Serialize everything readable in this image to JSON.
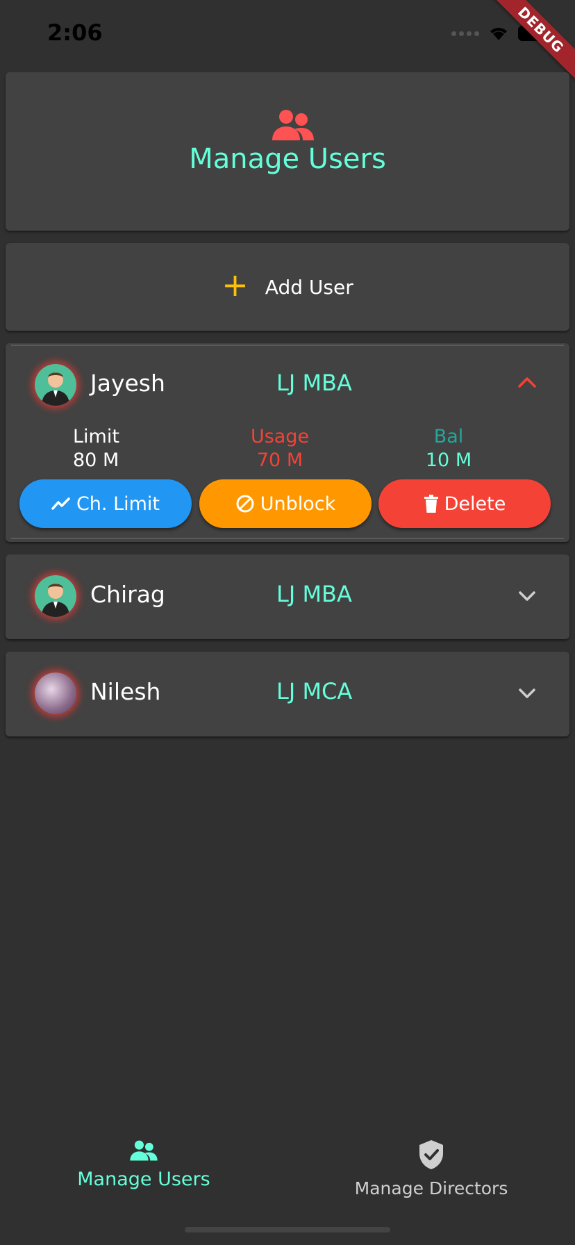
{
  "status_bar": {
    "time": "2:06"
  },
  "debug_banner": "DEBUG",
  "header": {
    "title": "Manage Users",
    "icon": "people-icon",
    "icon_color": "#ff5252"
  },
  "add_user": {
    "label": "Add User",
    "icon": "plus-icon",
    "icon_color": "#ffc107"
  },
  "users": [
    {
      "name": "Jayesh",
      "org": "LJ MBA",
      "expanded": true,
      "stats": [
        {
          "label": "Limit",
          "value": "80 M"
        },
        {
          "label": "Usage",
          "value": "70 M"
        },
        {
          "label": "Bal",
          "value": "10 M"
        }
      ],
      "actions": [
        {
          "label": "Ch. Limit",
          "icon": "trend-icon"
        },
        {
          "label": "Unblock",
          "icon": "block-icon"
        },
        {
          "label": "Delete",
          "icon": "trash-icon"
        }
      ]
    },
    {
      "name": "Chirag",
      "org": "LJ MBA",
      "expanded": false
    },
    {
      "name": "Nilesh",
      "org": "LJ MCA",
      "expanded": false
    }
  ],
  "bottom_nav": [
    {
      "label": "Manage Users",
      "icon": "people-icon",
      "active": true
    },
    {
      "label": "Manage Directors",
      "icon": "shield-check-icon",
      "active": false
    }
  ],
  "colors": {
    "background": "#303030",
    "card": "#424242",
    "accent": "#64ffda",
    "usage": "#f44336",
    "bal": "#26a69a",
    "btn_limit": "#2196f3",
    "btn_unblock": "#ff9800",
    "btn_delete": "#f44336"
  }
}
